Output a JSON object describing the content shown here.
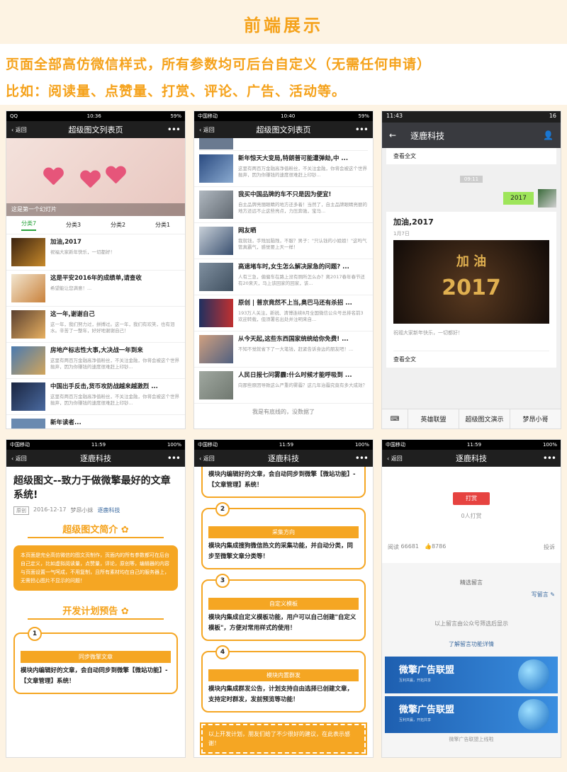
{
  "header": {
    "title": "前端展示",
    "line1": "页面全部高仿微信样式，所有参数均可后台自定义（无需任何申请）",
    "line2": "比如：阅读量、点赞量、打赏、评论、广告、活动等。"
  },
  "phone1": {
    "status": {
      "left": "QQ",
      "time": "10:36",
      "right": "59%"
    },
    "back": "返回",
    "title": "超级图文列表页",
    "more": "•••",
    "slide_caption": "这是第一个幻灯片",
    "tabs": [
      "分类7",
      "分类3",
      "分类2",
      "分类1"
    ],
    "items": [
      {
        "title": "加油,2017",
        "desc": "祝福大家新年快乐，一切都好！"
      },
      {
        "title": "这是平安2016年的成绩单,请查收",
        "desc": "希望能让您满意！..."
      },
      {
        "title": "这一年,谢谢自己",
        "desc": "这一年，我们努力过，拼搏过。这一年，我们有欢笑，也有泪水。辛苦了一整年，好好地谢谢自己！"
      },
      {
        "title": "房地产标志性大事,大决战一年到来",
        "desc": "这里有两百万金融高净值粉丝，不关注金融，你将会被这个世界抛弃，因为你赚钱的速度很难赶上印钞..."
      },
      {
        "title": "中国出手反击,货币攻防战越来越激烈 ...",
        "desc": "这里有两百万金融高净值粉丝，不关注金融，你将会被这个世界抛弃，因为你赚钱的速度很难赶上印钞..."
      },
      {
        "title": "新年读者...",
        "desc": ""
      }
    ]
  },
  "phone2": {
    "status": {
      "left": "中国移动",
      "time": "10:40",
      "right": "59%"
    },
    "back": "返回",
    "title": "超级图文列表页",
    "more": "•••",
    "items": [
      {
        "title": "新年惊天大变局,特朗普可能遭弹劾,中 ...",
        "desc": "这里有两百万金融高净值粉丝，不关注金融，你将会被这个世界抛弃，因为你赚钱的速度很难赶上印钞..."
      },
      {
        "title": "我买中国品牌的车不只是因为便宜!",
        "desc": "自主品牌亮丽眼睛的地方还多着！当然了，自主品牌眼睛亮丽的地方还远不止这些亮点，力压奔驰，宝马..."
      },
      {
        "title": "网友晒",
        "desc": "我就钱，手残加脑残，不服？男子：\"只认钱的小姐姐！\"这吗气管真霸气，感觉要上天一样！"
      },
      {
        "title": "高速堵车时,女生怎么解决尿急的问题? ...",
        "desc": "人有三急，偏偏车在路上没有厕所怎么办？离2017春年春节还有20来天，马上该回家的回家，该..."
      },
      {
        "title": "原创 | 普京竟然不上当,奥巴马还有杀招 ...",
        "desc": "193万人关注，新锐、清博连续8月全国微信公众号总排名前3欢迎转载，但须署名出处并注明来自..."
      },
      {
        "title": "从今天起,这些东西国家统统给你免费! ...",
        "desc": "不知不觉就省下了一大笔钱，赶紧告诉身边的朋友吧！..."
      },
      {
        "title": "人民日报七问雾霾:什么时候才能呼吸到 ...",
        "desc": "向那些原因导致这么严重的雾霾？这几年治霾究竟有多大成效？"
      }
    ],
    "footer": "我是有底线的，没数据了"
  },
  "phone3": {
    "status": {
      "left": "11:43",
      "right": "16"
    },
    "title": "逐鹿科技",
    "view_all": "查看全文",
    "time": "09:11",
    "bubble": "2017",
    "card_title": "加油,2017",
    "card_date": "1月7日",
    "img_big": "2017",
    "img_small": "加 油",
    "card_desc": "祝福大家新年快乐，一切都好！",
    "view_all2": "查看全文",
    "menu": [
      "英雄联盟",
      "超级图文演示",
      "梦昂小哥"
    ]
  },
  "phone4": {
    "status": {
      "left": "中国移动",
      "time": "11:59",
      "right": "100%"
    },
    "back": "返回",
    "title": "逐鹿科技",
    "more": "•••",
    "article_title": "超级图文--致力于做微擎最好的文章系统!",
    "tag": "原创",
    "date": "2016-12-17",
    "author": "梦昂小妹",
    "source": "逐鹿科技",
    "sec1": "超级图文简介",
    "intro": "本页面是完全高仿微信的图文页制作，页面内的所有参数都可在后台自己定义，比如虚拟阅读量，点赞量，评论，原创等，编辑器的内容与页面设置一气呵成，不用复制，且所有素材均在自己的服务器上，无需担心图片不显示的问题！",
    "sec2": "开发计划预告",
    "p1_num": "1",
    "p1_head": "同步微擎文章",
    "p1_text": "模块内编辑好的文章，会自动同步到微擎【微站功能】-【文章管理】系统！"
  },
  "phone5": {
    "status": {
      "left": "中国移动",
      "time": "11:59",
      "right": "100%"
    },
    "back": "返回",
    "title": "逐鹿科技",
    "more": "•••",
    "top_text": "模块内编辑好的文章，会自动同步到微擎【微站功能】-【文章管理】系统！",
    "plans": [
      {
        "num": "2",
        "head": "采集方向",
        "text": "模块内集成搜狗微信热文的采集功能，并自动分类，同步至微擎文章分类等！"
      },
      {
        "num": "3",
        "head": "自定义模板",
        "text": "模块内集成自定义模板功能，用户可以自己创建\"自定义模板\"，方便对常用样式的使用！"
      },
      {
        "num": "4",
        "head": "模块内置群发",
        "text": "模块内集成群发公告，计划支持自由选择已创建文章，支持定时群发，发前预览等功能！"
      }
    ],
    "bottom_note": "以上开发计划，朋友们给了不少很好的建议，在此表示感谢！"
  },
  "phone6": {
    "status": {
      "left": "中国移动",
      "time": "11:59",
      "right": "100%"
    },
    "back": "返回",
    "title": "逐鹿科技",
    "more": "•••",
    "reward_button": "打赏",
    "reward_count": "0人打赏",
    "read_label": "阅读",
    "read_count": "66681",
    "like_count": "8786",
    "report": "投诉",
    "selected": "精选留言",
    "write": "写留言",
    "filtered": "以上留言由公众号筛选后显示",
    "learn": "了解留言功能详情",
    "ad_title": "微擎广告联盟",
    "ad_sub": "互利共赢，开拓共享",
    "ad_link": "微擎广告联盟上线啦"
  }
}
